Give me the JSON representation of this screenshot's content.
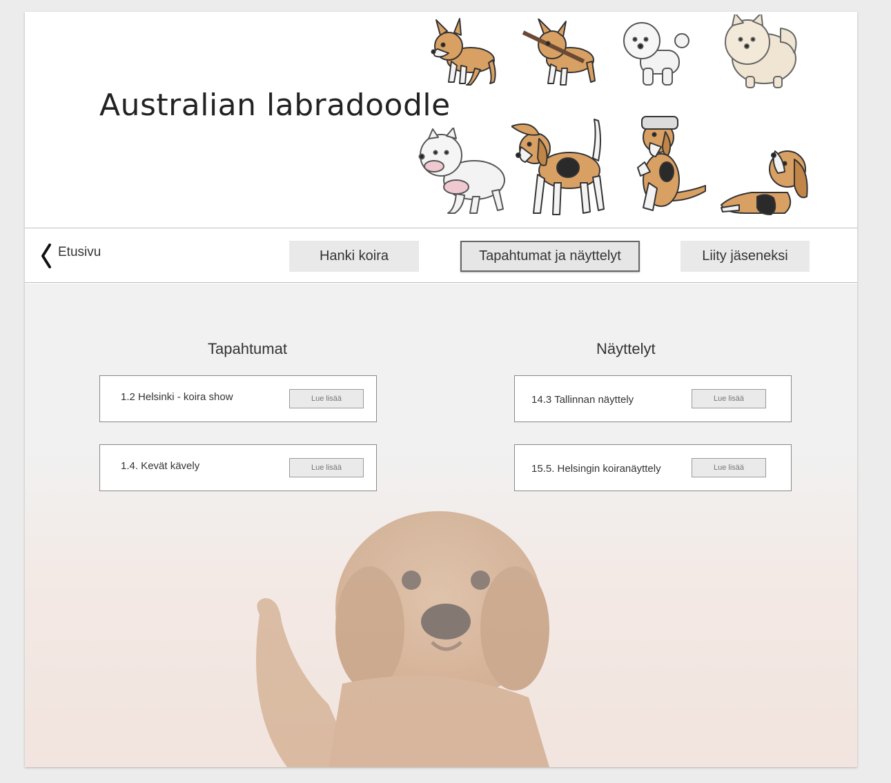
{
  "header": {
    "title": "Australian labradoodle",
    "illustrations": [
      "corgi-icon",
      "corgi-with-stick-icon",
      "bichon-icon",
      "pomeranian-icon",
      "bulldog-icon",
      "beagle-icon",
      "beagle-sitting-icon",
      "beagle-lying-icon"
    ]
  },
  "nav": {
    "back_label": "Etusivu",
    "items": [
      {
        "label": "Hanki koira",
        "active": false
      },
      {
        "label": "Tapahtumat ja näyttelyt",
        "active": true
      },
      {
        "label": "Liity jäseneksi",
        "active": false
      }
    ]
  },
  "events": {
    "title": "Tapahtumat",
    "items": [
      {
        "label": "1.2 Helsinki - koira show",
        "button": "Lue lisää"
      },
      {
        "label": "1.4. Kevät kävely",
        "button": "Lue lisää"
      }
    ]
  },
  "shows": {
    "title": "Näyttelyt",
    "items": [
      {
        "label": "14.3 Tallinnan näyttely",
        "button": "Lue lisää"
      },
      {
        "label": "15.5. Helsingin koiranäyttely",
        "button": "Lue lisää"
      }
    ]
  },
  "background": {
    "image": "labradoodle-photo"
  },
  "colors": {
    "tan": "#d9a064",
    "white": "#f3f3f3",
    "cream": "#efe5d2",
    "black": "#2a2a2a",
    "page_bg": "#ececec"
  }
}
